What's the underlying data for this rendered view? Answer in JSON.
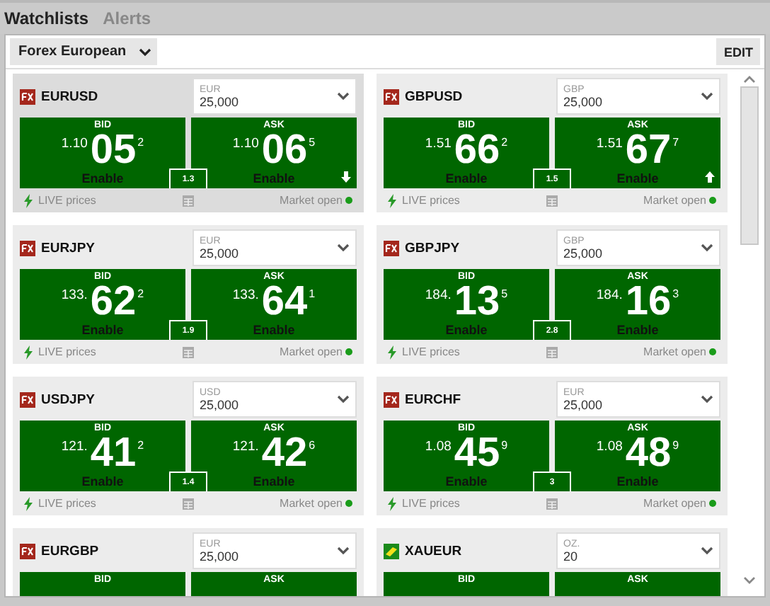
{
  "tabs": [
    {
      "label": "Watchlists",
      "selected": true
    },
    {
      "label": "Alerts",
      "selected": false
    }
  ],
  "toolbar": {
    "watchlist": "Forex European",
    "edit": "EDIT"
  },
  "cards": [
    {
      "kind": "fx",
      "symbol": "EURUSD",
      "currency": "EUR",
      "amount": "25,000",
      "selected": true,
      "bid": {
        "label": "BID",
        "big": "1.10",
        "pips": "05",
        "frac": "2",
        "action": "Enable"
      },
      "ask": {
        "label": "ASK",
        "big": "1.10",
        "pips": "06",
        "frac": "5",
        "action": "Enable",
        "rising": false,
        "falling": true
      },
      "spread": "1.3",
      "live": "LIVE prices",
      "status": "Market open"
    },
    {
      "kind": "fx",
      "symbol": "GBPUSD",
      "currency": "GBP",
      "amount": "25,000",
      "selected": false,
      "bid": {
        "label": "BID",
        "big": "1.51",
        "pips": "66",
        "frac": "2",
        "action": "Enable"
      },
      "ask": {
        "label": "ASK",
        "big": "1.51",
        "pips": "67",
        "frac": "7",
        "action": "Enable",
        "rising": true,
        "falling": false
      },
      "spread": "1.5",
      "live": "LIVE prices",
      "status": "Market open"
    },
    {
      "kind": "fx",
      "symbol": "EURJPY",
      "currency": "EUR",
      "amount": "25,000",
      "selected": false,
      "bid": {
        "label": "BID",
        "big": "133.",
        "pips": "62",
        "frac": "2",
        "action": "Enable"
      },
      "ask": {
        "label": "ASK",
        "big": "133.",
        "pips": "64",
        "frac": "1",
        "action": "Enable",
        "rising": false,
        "falling": false
      },
      "spread": "1.9",
      "live": "LIVE prices",
      "status": "Market open"
    },
    {
      "kind": "fx",
      "symbol": "GBPJPY",
      "currency": "GBP",
      "amount": "25,000",
      "selected": false,
      "bid": {
        "label": "BID",
        "big": "184.",
        "pips": "13",
        "frac": "5",
        "action": "Enable"
      },
      "ask": {
        "label": "ASK",
        "big": "184.",
        "pips": "16",
        "frac": "3",
        "action": "Enable",
        "rising": false,
        "falling": false
      },
      "spread": "2.8",
      "live": "LIVE prices",
      "status": "Market open"
    },
    {
      "kind": "fx",
      "symbol": "USDJPY",
      "currency": "USD",
      "amount": "25,000",
      "selected": false,
      "bid": {
        "label": "BID",
        "big": "121.",
        "pips": "41",
        "frac": "2",
        "action": "Enable"
      },
      "ask": {
        "label": "ASK",
        "big": "121.",
        "pips": "42",
        "frac": "6",
        "action": "Enable",
        "rising": false,
        "falling": false
      },
      "spread": "1.4",
      "live": "LIVE prices",
      "status": "Market open"
    },
    {
      "kind": "fx",
      "symbol": "EURCHF",
      "currency": "EUR",
      "amount": "25,000",
      "selected": false,
      "bid": {
        "label": "BID",
        "big": "1.08",
        "pips": "45",
        "frac": "9",
        "action": "Enable"
      },
      "ask": {
        "label": "ASK",
        "big": "1.08",
        "pips": "48",
        "frac": "9",
        "action": "Enable",
        "rising": false,
        "falling": false
      },
      "spread": "3",
      "live": "LIVE prices",
      "status": "Market open"
    },
    {
      "kind": "fx",
      "symbol": "EURGBP",
      "currency": "EUR",
      "amount": "25,000",
      "selected": false,
      "bid": {
        "label": "BID"
      },
      "ask": {
        "label": "ASK"
      }
    },
    {
      "kind": "gold",
      "symbol": "XAUEUR",
      "currency": "OZ.",
      "amount": "20",
      "selected": false,
      "bid": {
        "label": "BID"
      },
      "ask": {
        "label": "ASK"
      }
    }
  ]
}
